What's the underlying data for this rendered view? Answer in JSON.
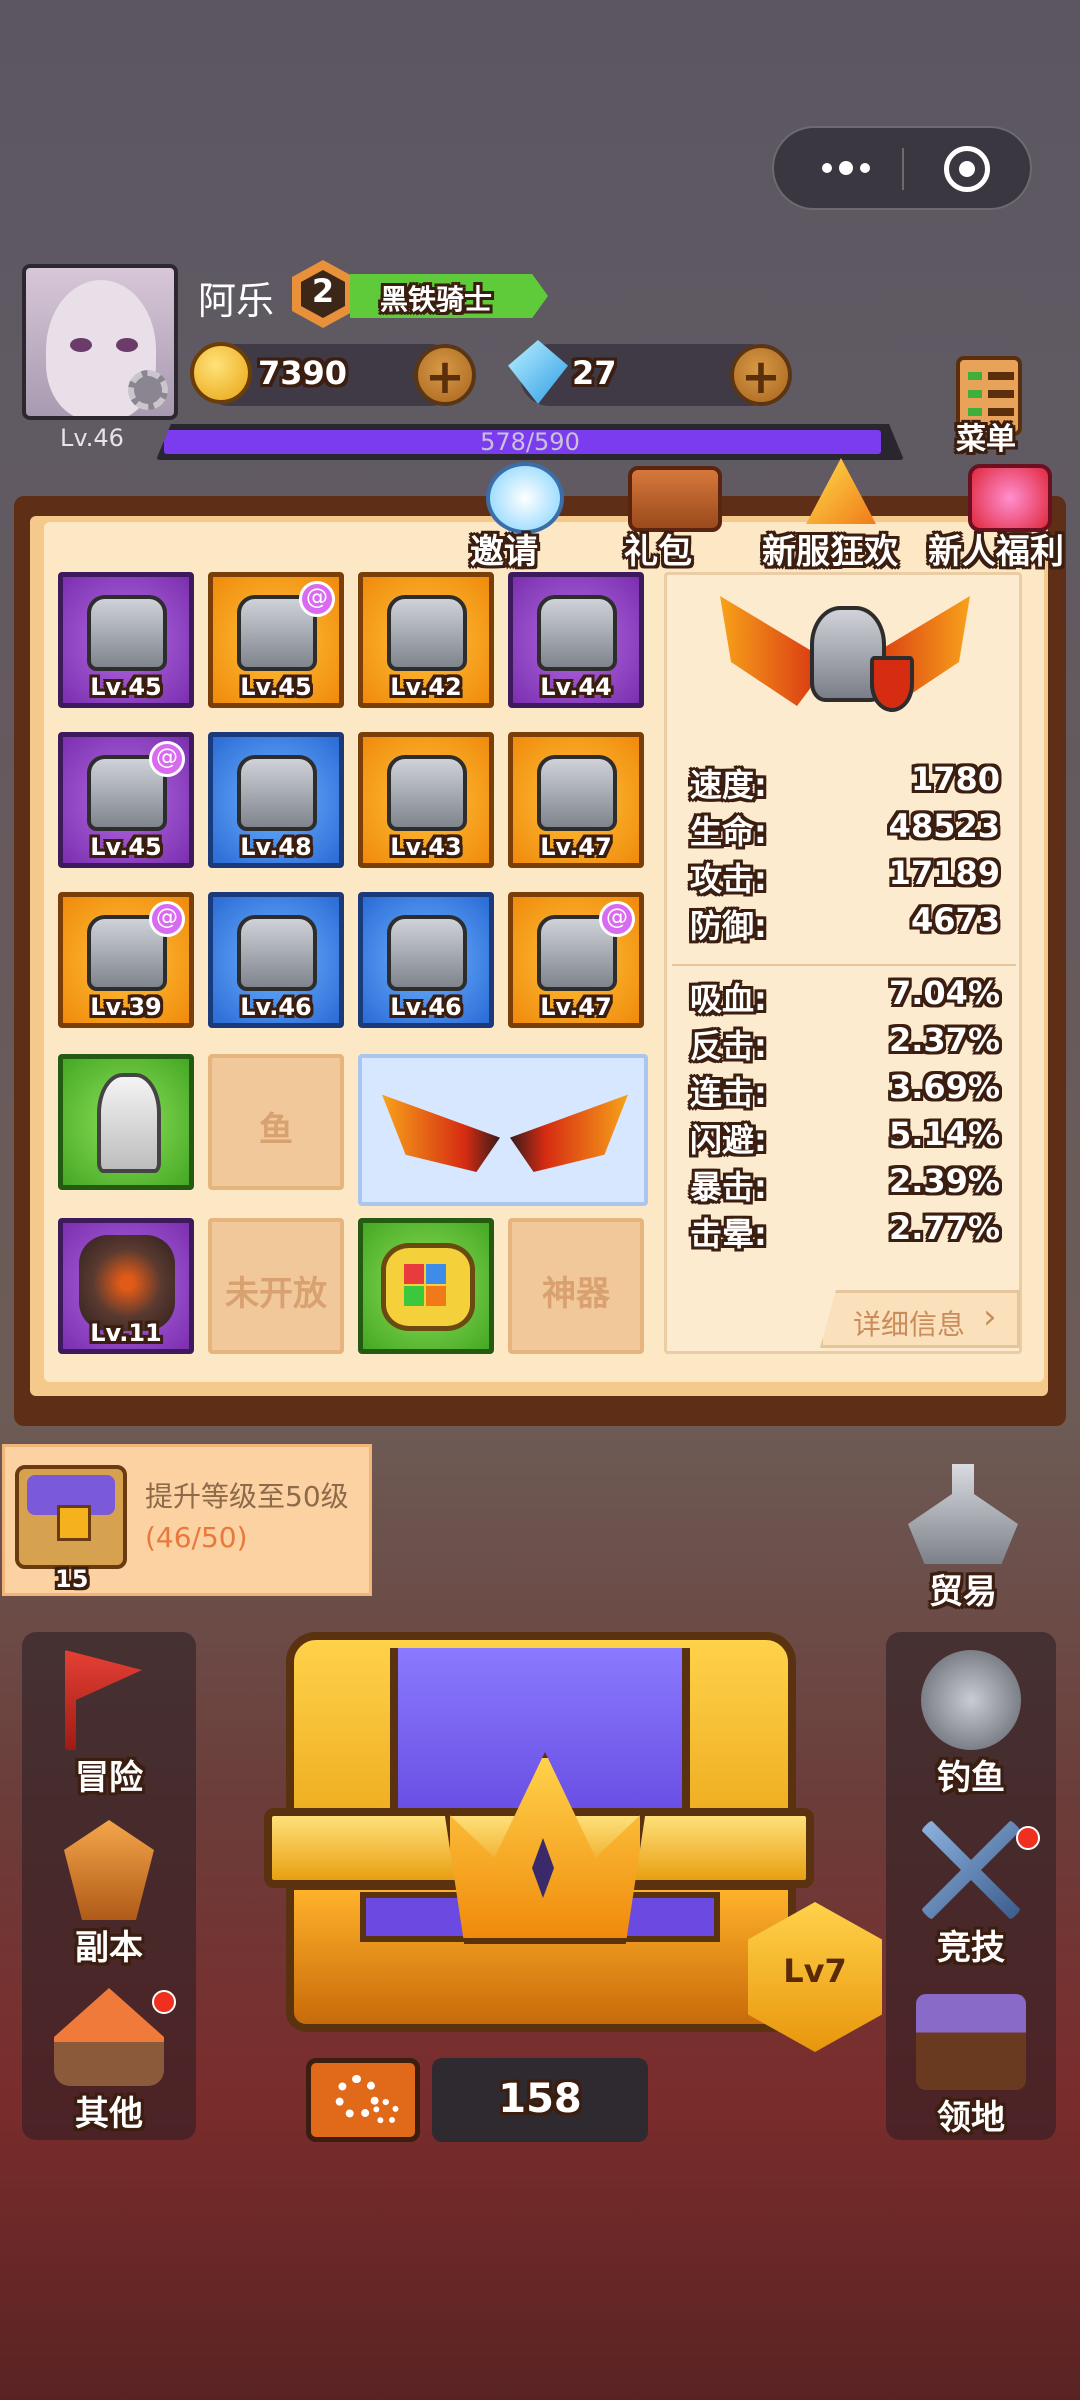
{
  "capsule": {
    "more_icon": "more-dots-icon",
    "target_icon": "target-icon"
  },
  "player": {
    "name": "阿乐",
    "rank_number": "2",
    "title": "黑铁骑士",
    "level": "Lv.46",
    "exp_text": "578/590",
    "exp_progress": 0.98
  },
  "currency": {
    "gold": "7390",
    "gems": "27"
  },
  "menu_label": "菜单",
  "top_actions": [
    {
      "label": "邀请",
      "icon": "invite-icon"
    },
    {
      "label": "礼包",
      "icon": "gift-pack-icon"
    },
    {
      "label": "新服狂欢",
      "icon": "new-server-carnival-icon"
    },
    {
      "label": "新人福利",
      "icon": "newbie-welfare-icon"
    }
  ],
  "equipment": [
    {
      "level": "Lv.45",
      "rarity": "purple",
      "icon": "helmet-icon",
      "special": false
    },
    {
      "level": "Lv.45",
      "rarity": "orange",
      "icon": "crusader-helmet-icon",
      "special": true
    },
    {
      "level": "Lv.42",
      "rarity": "orange",
      "icon": "necklace-icon",
      "special": false
    },
    {
      "level": "Lv.44",
      "rarity": "purple",
      "icon": "bracer-icon",
      "special": false
    },
    {
      "level": "Lv.45",
      "rarity": "purple",
      "icon": "armor-icon",
      "special": true
    },
    {
      "level": "Lv.48",
      "rarity": "blue",
      "icon": "gauntlet-icon",
      "special": false
    },
    {
      "level": "Lv.43",
      "rarity": "orange",
      "icon": "belt-icon",
      "special": false
    },
    {
      "level": "Lv.47",
      "rarity": "orange",
      "icon": "leg-armor-icon",
      "special": false
    },
    {
      "level": "Lv.39",
      "rarity": "orange",
      "icon": "drill-lance-icon",
      "special": true
    },
    {
      "level": "Lv.46",
      "rarity": "blue",
      "icon": "ring-icon",
      "special": false
    },
    {
      "level": "Lv.46",
      "rarity": "blue",
      "icon": "boots-icon",
      "special": false
    },
    {
      "level": "Lv.47",
      "rarity": "orange",
      "icon": "shield-icon",
      "special": true
    }
  ],
  "extra_slots": {
    "mount_icon": "horse-mount-icon",
    "fish_label": "鱼",
    "wings_icon": "flame-wings-icon",
    "pet_level": "Lv.11",
    "pet_icon": "golem-pet-icon",
    "locked_label": "未开放",
    "trinket_icon": "rubik-amulet-icon",
    "artifact_label": "神器"
  },
  "stats_basic": [
    {
      "key": "速度:",
      "value": "1780"
    },
    {
      "key": "生命:",
      "value": "48523"
    },
    {
      "key": "攻击:",
      "value": "17189"
    },
    {
      "key": "防御:",
      "value": "4673"
    }
  ],
  "stats_extra": [
    {
      "key": "吸血:",
      "value": "7.04%"
    },
    {
      "key": "反击:",
      "value": "2.37%"
    },
    {
      "key": "连击:",
      "value": "3.69%"
    },
    {
      "key": "闪避:",
      "value": "5.14%"
    },
    {
      "key": "暴击:",
      "value": "2.39%"
    },
    {
      "key": "击晕:",
      "value": "2.77%"
    }
  ],
  "detail_button": "详细信息",
  "quest": {
    "text": "提升等级至50级",
    "progress_text": "(46/50)",
    "reward_count": "15"
  },
  "left_menu": [
    {
      "label": "冒险",
      "icon": "adventure-flag-icon"
    },
    {
      "label": "副本",
      "icon": "dungeon-wings-icon"
    },
    {
      "label": "其他",
      "icon": "other-house-icon"
    }
  ],
  "right_menu": [
    {
      "label": "贸易",
      "icon": "trade-ship-icon"
    },
    {
      "label": "钓鱼",
      "icon": "fishing-icon"
    },
    {
      "label": "竞技",
      "icon": "arena-swords-icon"
    },
    {
      "label": "领地",
      "icon": "territory-icon"
    }
  ],
  "chest": {
    "level_badge": "Lv7",
    "count": "158"
  },
  "colors": {
    "exp_bar": "#7b3cf0",
    "title_ribbon": "#5fcb3a",
    "paper": "#fde8c6"
  }
}
